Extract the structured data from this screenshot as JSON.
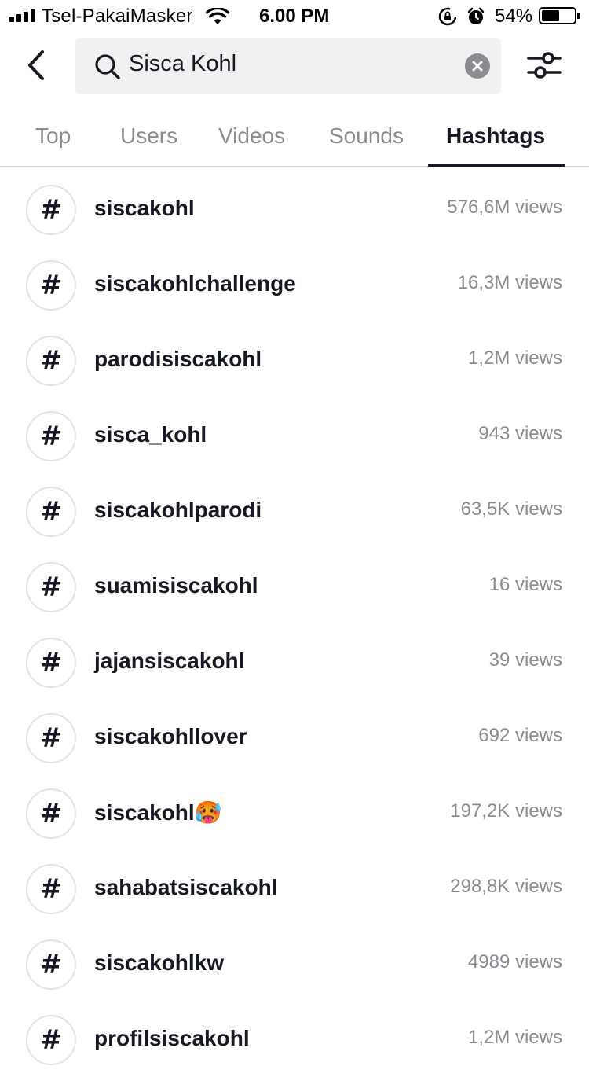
{
  "status_bar": {
    "carrier": "Tsel-PakaiMasker",
    "time": "6.00 PM",
    "battery": "54%",
    "battery_level": 0.54,
    "icons": [
      "signal-icon",
      "wifi-icon",
      "rotation-lock-icon",
      "alarm-icon",
      "battery-icon"
    ]
  },
  "search": {
    "query": "Sisca Kohl",
    "icons": [
      "back-icon",
      "search-icon",
      "clear-icon",
      "filter-icon"
    ]
  },
  "tabs": [
    {
      "label": "Top"
    },
    {
      "label": "Users"
    },
    {
      "label": "Videos"
    },
    {
      "label": "Sounds"
    },
    {
      "label": "Hashtags",
      "active": true
    }
  ],
  "hashtag_symbol": "#",
  "hashtags": [
    {
      "name": "siscakohl",
      "views": "576,6M views"
    },
    {
      "name": "siscakohlchallenge",
      "views": "16,3M views"
    },
    {
      "name": "parodisiscakohl",
      "views": "1,2M views"
    },
    {
      "name": "sisca_kohl",
      "views": "943 views"
    },
    {
      "name": "siscakohlparodi",
      "views": "63,5K views"
    },
    {
      "name": "suamisiscakohl",
      "views": "16 views"
    },
    {
      "name": "jajansiscakohl",
      "views": "39 views"
    },
    {
      "name": "siscakohllover",
      "views": "692 views"
    },
    {
      "name": "siscakohl🥵",
      "views": "197,2K views"
    },
    {
      "name": "sahabatsiscakohl",
      "views": "298,8K views"
    },
    {
      "name": "siscakohlkw",
      "views": "4989 views"
    },
    {
      "name": "profilsiscakohl",
      "views": "1,2M views"
    }
  ]
}
